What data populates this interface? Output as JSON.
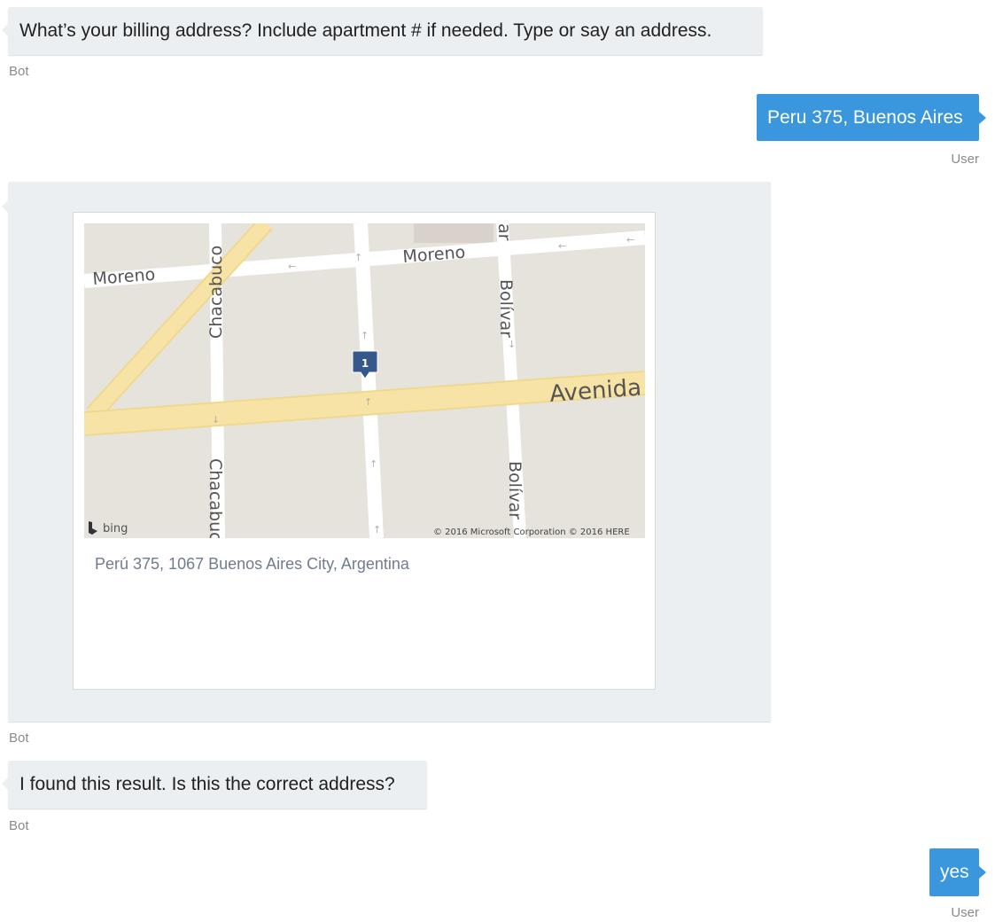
{
  "messages": {
    "bot_question": "What’s your billing address? Include apartment # if needed. Type or say an address.",
    "bot_label_1": "Bot",
    "user_address": "Peru 375, Buenos Aires",
    "user_label_1": "User",
    "bot_label_2": "Bot",
    "bot_confirm": "I found this result. Is this the correct address?",
    "bot_label_3": "Bot",
    "user_yes": "yes",
    "user_label_2": "User"
  },
  "card": {
    "address": "Perú 375, 1067 Buenos Aires City, Argentina",
    "map": {
      "streets": {
        "moreno_left": "Moreno",
        "moreno_right": "Moreno",
        "chacabuco_top": "Chacabuco",
        "chacabuco_bottom": "Chacabuco",
        "bolivar_top": "Bolívar",
        "bolivar_bottom": "Bolívar",
        "avenida": "Avenida"
      },
      "pin_number": "1",
      "logo": "bing",
      "copyright": "© 2016 Microsoft Corporation © 2016 HERE"
    }
  },
  "colors": {
    "user_bubble": "#3a96dd",
    "bot_bubble": "#eceff1",
    "map_land": "#e6e2dc",
    "map_major_road": "#f7e3a6",
    "pin": "#36578c"
  }
}
